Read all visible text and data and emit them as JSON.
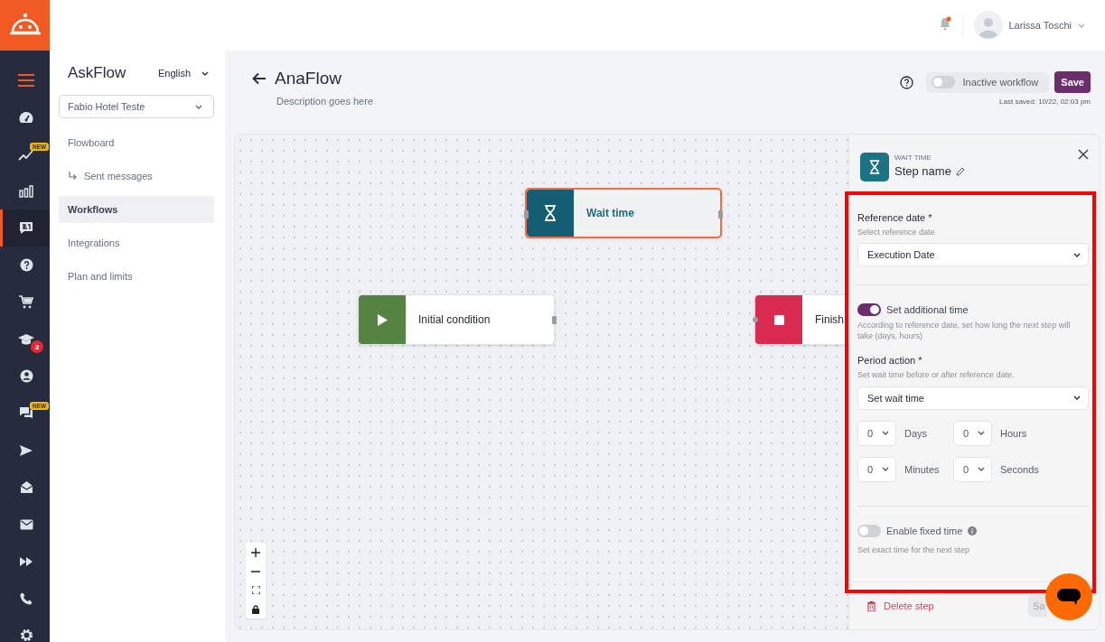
{
  "rail": {
    "items": [
      {
        "kind": "menu",
        "selected": false
      },
      {
        "kind": "gauge",
        "selected": false
      },
      {
        "kind": "trend",
        "selected": false,
        "badge": {
          "kind": "tag",
          "text": "NEW"
        }
      },
      {
        "kind": "bars",
        "selected": false
      },
      {
        "kind": "chat-square",
        "selected": true
      },
      {
        "kind": "help",
        "selected": false
      },
      {
        "kind": "cart",
        "selected": false
      },
      {
        "kind": "cap",
        "selected": false,
        "badge": {
          "kind": "count",
          "text": "3"
        }
      },
      {
        "kind": "user",
        "selected": false
      },
      {
        "kind": "chats",
        "selected": false,
        "badge": {
          "kind": "tag",
          "text": "NEW"
        }
      },
      {
        "kind": "send",
        "selected": false
      },
      {
        "kind": "mail-open",
        "selected": false
      },
      {
        "kind": "mail",
        "selected": false
      },
      {
        "kind": "forward",
        "selected": false
      },
      {
        "kind": "phone",
        "selected": false
      },
      {
        "kind": "gear",
        "selected": false
      }
    ]
  },
  "top_bar": {
    "notifications": {
      "unread": true
    },
    "user": {
      "name": "Larissa Toschi"
    }
  },
  "sidebar": {
    "title": "AskFlow",
    "language": "English",
    "property_select": {
      "value": "Fabio Hotel Teste"
    },
    "items": [
      {
        "label": "Flowboard",
        "selected": false,
        "children": [
          {
            "label": "Sent messages",
            "selected": false
          }
        ]
      },
      {
        "label": "Workflows",
        "selected": true
      },
      {
        "label": "Integrations",
        "selected": false
      },
      {
        "label": "Plan and limits",
        "selected": false
      }
    ]
  },
  "header": {
    "title": "AnaFlow",
    "description": "Description goes here",
    "status_toggle": {
      "label": "Inactive workflow",
      "on": false
    },
    "save_button": "Save",
    "last_saved": "Last saved: 10/22, 02:03 pm"
  },
  "canvas": {
    "nodes": [
      {
        "kind": "wait",
        "label": "Wait time",
        "selected": true
      },
      {
        "kind": "start",
        "label": "Initial condition",
        "selected": false
      },
      {
        "kind": "finish",
        "label": "Finish",
        "selected": false
      }
    ]
  },
  "panel": {
    "highlighted": true,
    "type_label": "WAIT TIME",
    "step_name": "Step name",
    "reference_date": {
      "label": "Reference date *",
      "hint": "Select reference date",
      "value": "Execution Date"
    },
    "additional_time": {
      "label": "Set additional time",
      "on": true,
      "hint": "According to reference date, set how long the next step will take (days, hours)"
    },
    "period_action": {
      "label": "Period action *",
      "hint": "Set wait time before or after reference date.",
      "value": "Set wait time"
    },
    "durations": [
      {
        "value": "0",
        "unit": "Days"
      },
      {
        "value": "0",
        "unit": "Hours"
      },
      {
        "value": "0",
        "unit": "Minutes"
      },
      {
        "value": "0",
        "unit": "Seconds"
      }
    ],
    "fixed_time": {
      "label": "Enable fixed time",
      "on": false,
      "hint": "Set exact time for the next step"
    },
    "delete_button": "Delete step",
    "save_button": "Sa"
  }
}
